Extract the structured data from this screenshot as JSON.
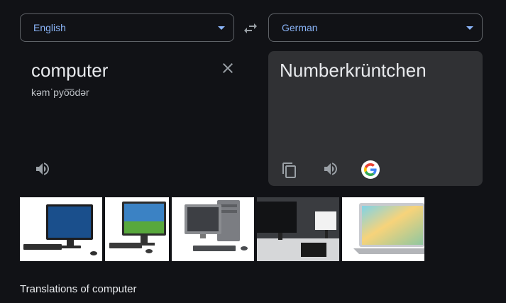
{
  "source_lang": {
    "label": "English"
  },
  "target_lang": {
    "label": "German"
  },
  "source": {
    "text": "computer",
    "phonetic": "kəmˈpyo͞odər"
  },
  "target": {
    "text": "Numberkrüntchen"
  },
  "icons": {
    "swap": "swap-arrows-icon",
    "clear": "close-icon",
    "speak": "speaker-icon",
    "copy": "copy-icon",
    "google": "google-g-logo"
  },
  "images": [
    {
      "name": "monitor-with-keyboard"
    },
    {
      "name": "widescreen-monitor-landscape"
    },
    {
      "name": "desktop-tower-with-monitor"
    },
    {
      "name": "office-desk-monitors"
    },
    {
      "name": "laptop-colorful-screen"
    }
  ],
  "translations_heading": "Translations of computer",
  "colors": {
    "background": "#111216",
    "panel": "#303134",
    "accent": "#8ab4f8",
    "text": "#e8eaed",
    "muted_icon": "#9aa0a6"
  }
}
